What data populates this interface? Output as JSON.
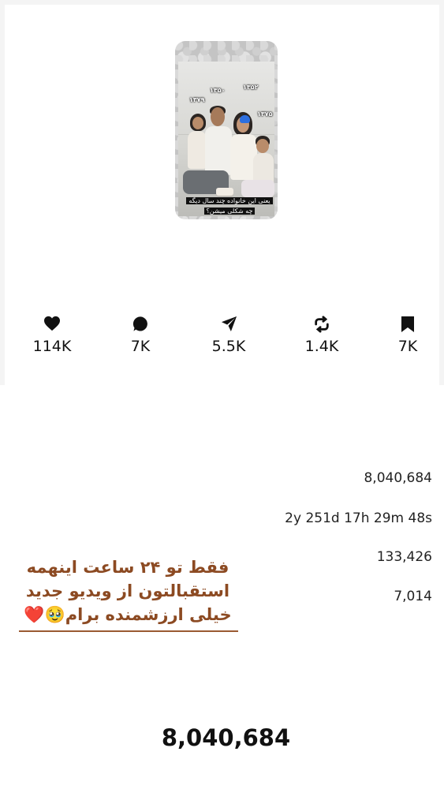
{
  "thumbnail": {
    "years": {
      "mother": "۱۳۵۲",
      "father": "۱۳۵۰",
      "daughter": "۱۳۷۹",
      "son": "۱۳۷۵"
    },
    "caption_line1": "یعنی این خانواده چند سال دیگه",
    "caption_line2": "چه شکلی میشن؟"
  },
  "stats": [
    {
      "icon": "heart-icon",
      "value": "114K"
    },
    {
      "icon": "comment-icon",
      "value": "7K"
    },
    {
      "icon": "share-icon",
      "value": "5.5K"
    },
    {
      "icon": "repost-icon",
      "value": "1.4K"
    },
    {
      "icon": "bookmark-icon",
      "value": "7K"
    }
  ],
  "details": {
    "views": "8,040,684",
    "duration": "2y 251d 17h 29m 48s",
    "row3": "133,426",
    "row4": "7,014"
  },
  "sticker": {
    "line1": "فقط تو ۲۴ ساعت اینهمه",
    "line2": "استقبالتون از ویدیو جدید",
    "line3": "خیلی ارزشمنده برام🥹❤️"
  },
  "total_views": "8,040,684"
}
